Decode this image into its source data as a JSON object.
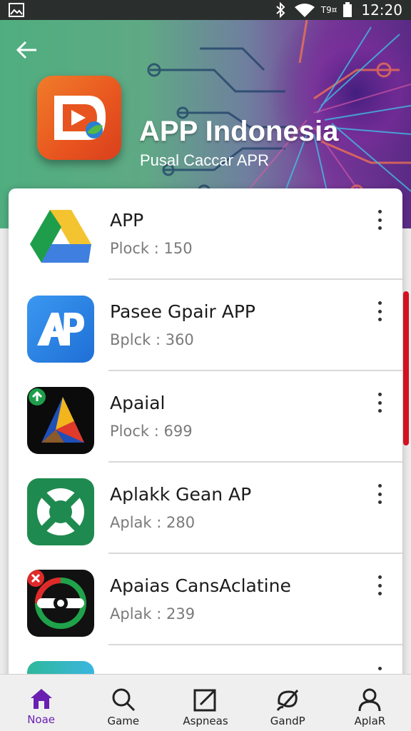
{
  "status_bar": {
    "signal_pill": "T9¤",
    "time": "12:20"
  },
  "header": {
    "title": "APP Indonesia",
    "subtitle": "Pusal Caccar APR",
    "colors": {
      "accent_left": "#4fae7f",
      "accent_right": "#5a2a86"
    }
  },
  "list": [
    {
      "name": "APP",
      "meta": "Plock : 150",
      "icon": "drive-triangle-icon"
    },
    {
      "name": "Pasee Gpair APP",
      "meta": "Bplck : 360",
      "icon": "ap-logo-icon"
    },
    {
      "name": "Apaial",
      "meta": "Plock : 699",
      "icon": "colorful-triangle-icon"
    },
    {
      "name": "Aplakk Gean AP",
      "meta": "Aplak : 280",
      "icon": "green-cross-icon"
    },
    {
      "name": "Apaias CansAclatine",
      "meta": "Aplak : 239",
      "icon": "dark-ring-icon"
    }
  ],
  "nav": [
    {
      "label": "Noae",
      "icon": "home-icon",
      "active": true
    },
    {
      "label": "Game",
      "icon": "search-icon",
      "active": false
    },
    {
      "label": "Aspneas",
      "icon": "edit-icon",
      "active": false
    },
    {
      "label": "GandP",
      "icon": "brush-icon",
      "active": false
    },
    {
      "label": "AplaR",
      "icon": "user-icon",
      "active": false
    }
  ],
  "colors": {
    "scrollbar": "#d5101f",
    "nav_active": "#6a1fb2"
  }
}
